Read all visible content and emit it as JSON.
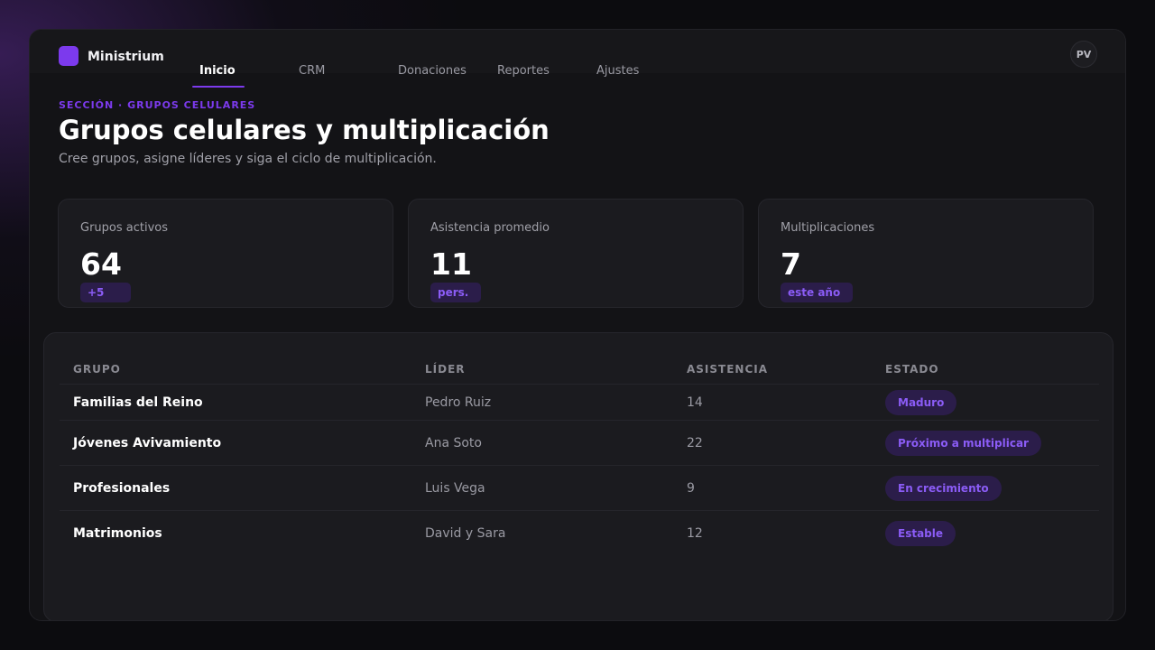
{
  "app": {
    "brand": "Ministrium",
    "avatar_initials": "PV"
  },
  "nav": {
    "tabs": [
      {
        "label": "Inicio",
        "active": true
      },
      {
        "label": "CRM",
        "active": false
      },
      {
        "label": "Donaciones",
        "active": false
      },
      {
        "label": "Reportes",
        "active": false
      },
      {
        "label": "Ajustes",
        "active": false
      }
    ]
  },
  "header": {
    "eyebrow": "SECCIÓN · GRUPOS CELULARES",
    "title": "Grupos celulares y multiplicación",
    "subtitle": "Cree grupos, asigne líderes y siga el ciclo de multiplicación."
  },
  "stats": [
    {
      "label": "Grupos activos",
      "value": "64",
      "badge": "+5"
    },
    {
      "label": "Asistencia promedio",
      "value": "11",
      "badge": "pers."
    },
    {
      "label": "Multiplicaciones",
      "value": "7",
      "badge": "este año"
    }
  ],
  "table": {
    "columns": [
      "GRUPO",
      "LÍDER",
      "ASISTENCIA",
      "ESTADO"
    ],
    "rows": [
      {
        "group": "Familias del Reino",
        "leader": "Pedro Ruiz",
        "attendance": "14",
        "status": "Maduro"
      },
      {
        "group": "Jóvenes Avivamiento",
        "leader": "Ana Soto",
        "attendance": "22",
        "status": "Próximo a multiplicar"
      },
      {
        "group": "Profesionales",
        "leader": "Luis Vega",
        "attendance": "9",
        "status": "En crecimiento"
      },
      {
        "group": "Matrimonios",
        "leader": "David y Sara",
        "attendance": "12",
        "status": "Estable"
      }
    ]
  },
  "colors": {
    "accent": "#7c3aed",
    "background": "#0c0c0f",
    "card": "#1b1b1f"
  }
}
